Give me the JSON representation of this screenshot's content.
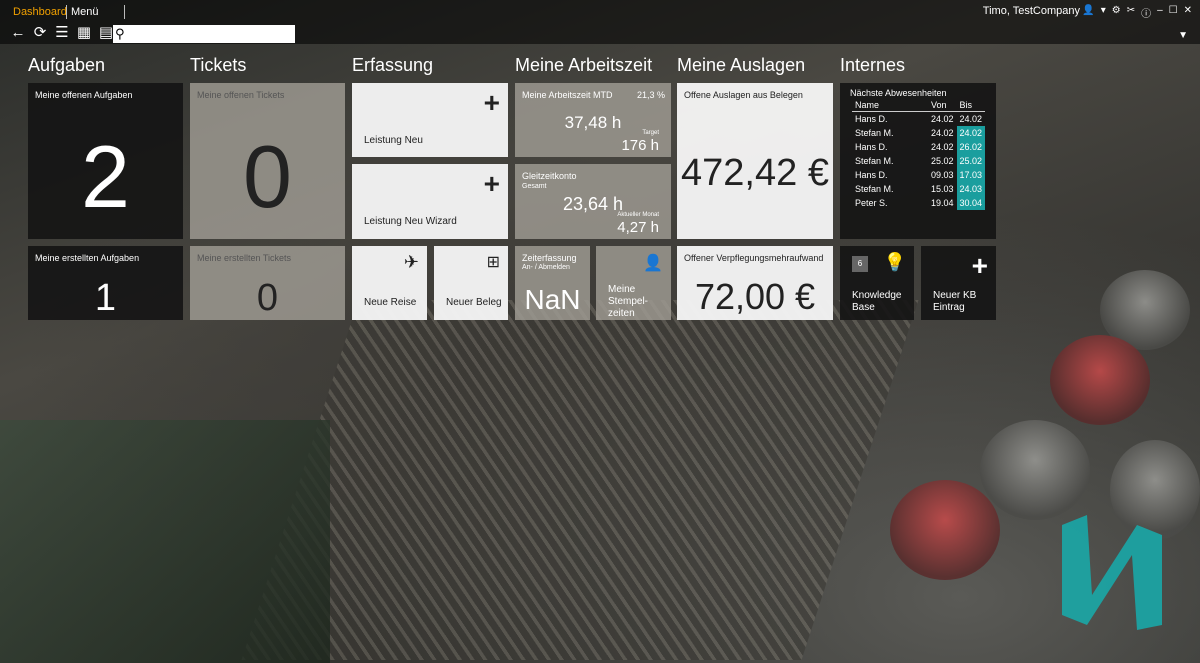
{
  "nav": {
    "dashboard": "Dashboard",
    "menu": "Menü"
  },
  "user": "Timo, TestCompany",
  "search": {
    "placeholder": ""
  },
  "sections": {
    "aufgaben": "Aufgaben",
    "tickets": "Tickets",
    "erfassung": "Erfassung",
    "arbeitszeit": "Meine Arbeitszeit",
    "auslagen": "Meine Auslagen",
    "internes": "Internes"
  },
  "tiles": {
    "offene_aufgaben": {
      "label": "Meine offenen Aufgaben",
      "value": "2"
    },
    "erstellte_aufgaben": {
      "label": "Meine erstellten Aufgaben",
      "value": "1"
    },
    "offene_tickets": {
      "label": "Meine offenen Tickets",
      "value": "0"
    },
    "erstellte_tickets": {
      "label": "Meine erstellten Tickets",
      "value": "0"
    },
    "leistung_neu": {
      "label": "Leistung Neu"
    },
    "leistung_wizard": {
      "label": "Leistung Neu Wizard"
    },
    "neue_reise": {
      "label": "Neue Reise"
    },
    "neuer_beleg": {
      "label": "Neuer Beleg"
    },
    "arbeitszeit_mtd": {
      "label": "Meine Arbeitszeit MTD",
      "percent": "21,3 %",
      "value": "37,48 h",
      "target_label": "Target",
      "target": "176 h"
    },
    "gleitzeit": {
      "label": "Gleitzeitkonto",
      "sub": "Gesamt",
      "value": "23,64 h",
      "month_label": "Aktueller Monat",
      "month": "4,27 h"
    },
    "zeiterfassung": {
      "label": "Zeiterfassung",
      "sub": "An- / Abmelden",
      "value": "NaN"
    },
    "stempelzeiten": {
      "label": "Meine Stempel-zeiten"
    },
    "auslagen_belege": {
      "label": "Offene Auslagen aus Belegen",
      "value": "472,42 €"
    },
    "verpflegung": {
      "label": "Offener Verpflegungsmehraufwand",
      "value": "72,00 €"
    },
    "knowledge_base": {
      "label": "Knowledge Base",
      "badge": "6"
    },
    "neuer_kb": {
      "label": "Neuer KB Eintrag"
    }
  },
  "absences": {
    "title": "Nächste Abwesenheiten",
    "headers": [
      "Name",
      "Von",
      "Bis"
    ],
    "rows": [
      {
        "name": "Hans D.",
        "von": "24.02",
        "bis": "24.02"
      },
      {
        "name": "Stefan M.",
        "von": "24.02",
        "bis": "24.02"
      },
      {
        "name": "Hans D.",
        "von": "24.02",
        "bis": "26.02"
      },
      {
        "name": "Stefan M.",
        "von": "25.02",
        "bis": "25.02"
      },
      {
        "name": "Hans D.",
        "von": "09.03",
        "bis": "17.03"
      },
      {
        "name": "Stefan M.",
        "von": "15.03",
        "bis": "24.03"
      },
      {
        "name": "Peter S.",
        "von": "19.04",
        "bis": "30.04"
      }
    ],
    "highlight_color": "#1a9e9e"
  },
  "colors": {
    "accent": "#f0a000",
    "teal": "#1a9e9e"
  }
}
